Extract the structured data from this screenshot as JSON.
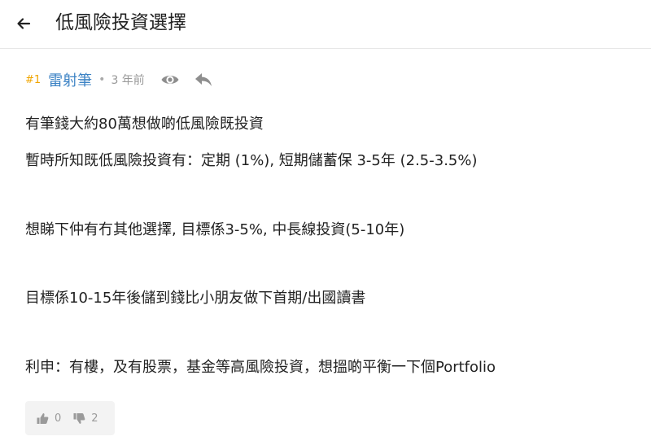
{
  "header": {
    "back_icon": "arrow-left-icon",
    "title": "低風險投資選擇"
  },
  "post": {
    "number": "#1",
    "author": "雷射筆",
    "separator": "•",
    "time": "3 年前",
    "view_icon": "eye-icon",
    "reply_icon": "reply-icon",
    "content_lines": [
      "有筆錢大約80萬想做啲低風險既投資",
      "暫時所知既低風險投資有：定期 (1%), 短期儲蓄保 3-5年 (2.5-3.5%)",
      "想睇下仲有冇其他選擇, 目標係3-5%, 中長線投資(5-10年)",
      "目標係10-15年後儲到錢比小朋友做下首期/出國讀書",
      "利申：有樓，及有股票，基金等高風險投資，想搵啲平衡一下個Portfolio"
    ],
    "likes": "0",
    "dislikes": "2",
    "like_icon": "thumbs-up-icon",
    "dislike_icon": "thumbs-down-icon"
  },
  "colors": {
    "post_number": "#f0a500",
    "author": "#3b82c4",
    "muted": "#999999",
    "divider": "#e6e6e6",
    "vote_bg": "#f3f3f3"
  }
}
